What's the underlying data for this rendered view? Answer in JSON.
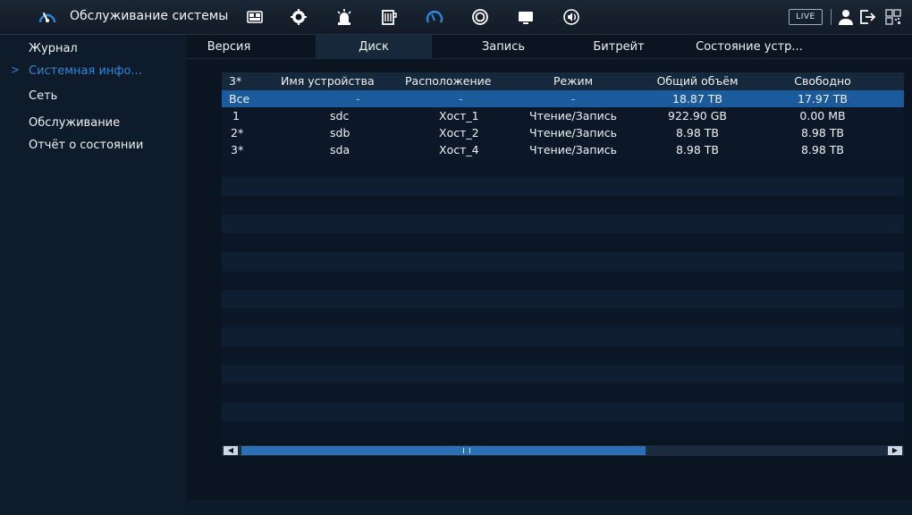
{
  "header": {
    "title": "Обслуживание системы",
    "icons": [
      "camera-icon",
      "network-icon",
      "alarm-icon",
      "storage-icon",
      "maintenance-icon",
      "record-icon",
      "display-icon",
      "audio-icon"
    ],
    "live_label": "LIVE",
    "right_icons": [
      "user-icon",
      "logout-icon",
      "qr-icon"
    ]
  },
  "sidebar": {
    "items": [
      {
        "label": "Журнал"
      },
      {
        "label": "Системная инфо..."
      },
      {
        "label": "Сеть"
      },
      {
        "label": "Обслуживание"
      },
      {
        "label": "Отчёт о состоянии"
      }
    ],
    "active_arrow": ">"
  },
  "tabs": [
    {
      "label": "Версия"
    },
    {
      "label": "Диск"
    },
    {
      "label": "Запись"
    },
    {
      "label": "Битрейт"
    },
    {
      "label": "Состояние устр..."
    }
  ],
  "table": {
    "columns": [
      "3*",
      "Имя устройства",
      "Расположение",
      "Режим",
      "Общий объём",
      "Свободно"
    ],
    "rows": [
      [
        "Все",
        "-",
        "-",
        "-",
        "18.87 TB",
        "17.97 TB"
      ],
      [
        "1",
        "sdc",
        "Хост_1",
        "Чтение/Запись",
        "922.90 GB",
        "0.00 MB"
      ],
      [
        "2*",
        "sdb",
        "Хост_2",
        "Чтение/Запись",
        "8.98 TB",
        "8.98 TB"
      ],
      [
        "3*",
        "sda",
        "Хост_4",
        "Чтение/Запись",
        "8.98 TB",
        "8.98 TB"
      ]
    ]
  },
  "scrollbar": {
    "left_arrow": "◀",
    "right_arrow": "▶",
    "grip": "III"
  },
  "colors": {
    "accent": "#2f86d6",
    "selected_row": "#1b5a9b",
    "background": "#0b1420"
  }
}
